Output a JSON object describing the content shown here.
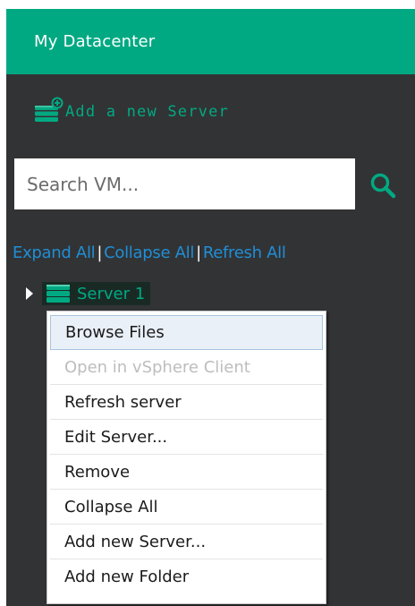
{
  "header": {
    "title": "My Datacenter"
  },
  "toolbar": {
    "add_server_label": "Add a new Server"
  },
  "search": {
    "placeholder": "Search VM..."
  },
  "tree_actions": {
    "expand_all": "Expand All",
    "collapse_all": "Collapse All",
    "refresh_all": "Refresh All",
    "separator": "|"
  },
  "tree": {
    "nodes": [
      {
        "label": "Server 1",
        "expanded": false,
        "icon": "server-stack-icon"
      }
    ]
  },
  "context_menu": {
    "items": [
      {
        "label": "Browse Files",
        "state": "highlighted"
      },
      {
        "label": "Open in vSphere Client",
        "state": "disabled"
      },
      {
        "label": "Refresh server",
        "state": "enabled"
      },
      {
        "label": "Edit Server...",
        "state": "enabled"
      },
      {
        "label": "Remove",
        "state": "enabled"
      },
      {
        "label": "Collapse All",
        "state": "enabled"
      },
      {
        "label": "Add new Server...",
        "state": "enabled"
      },
      {
        "label": "Add new Folder",
        "state": "enabled"
      }
    ]
  },
  "colors": {
    "accent": "#01a982",
    "panel_background": "#323335",
    "link": "#1f8fd6",
    "menu_background": "#ffffff",
    "disabled_text": "#bdbdbd"
  }
}
